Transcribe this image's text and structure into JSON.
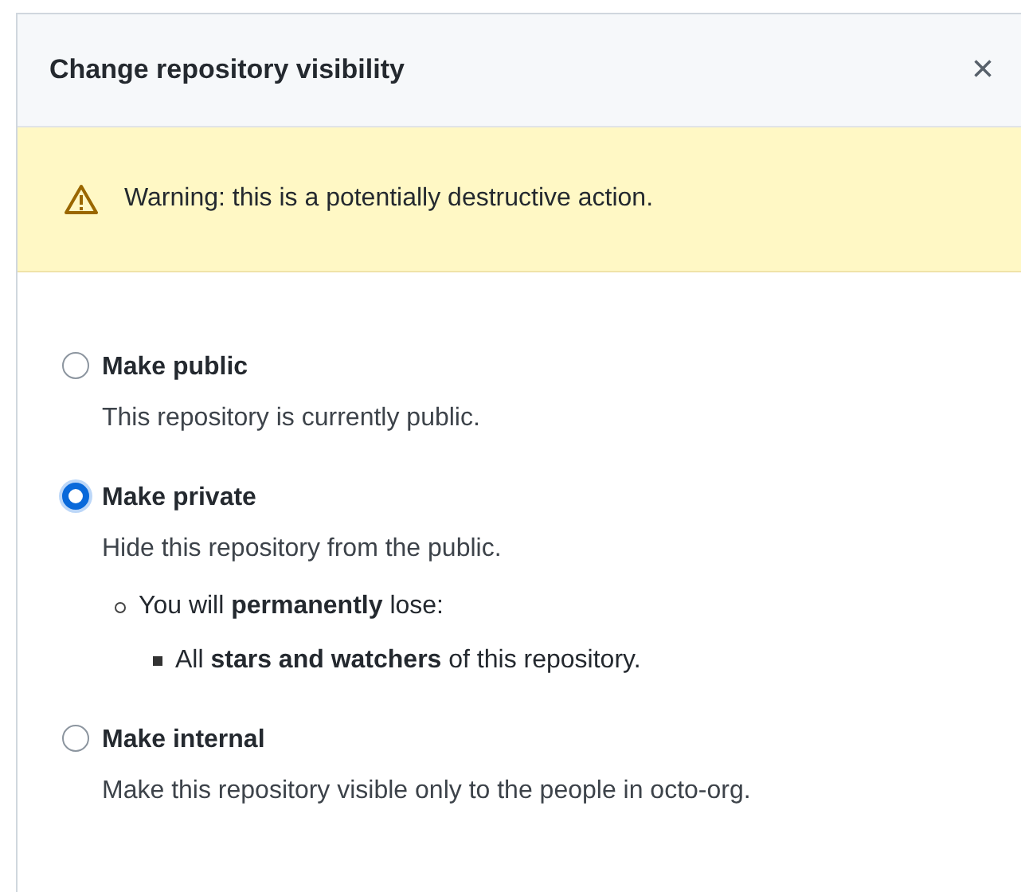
{
  "dialog": {
    "title": "Change repository visibility",
    "close": "×",
    "warning": {
      "text": "Warning: this is a potentially destructive action."
    },
    "options": [
      {
        "label": "Make public",
        "description": "This repository is currently public.",
        "selected": false
      },
      {
        "label": "Make private",
        "description": "Hide this repository from the public.",
        "selected": true,
        "details": [
          {
            "text": "You will **permanently** lose:",
            "children": [
              {
                "text": "All **stars and watchers** of this repository."
              }
            ]
          }
        ]
      },
      {
        "label": "Make internal",
        "description": "Make this repository visible only to the people in octo-org.",
        "selected": false
      }
    ]
  }
}
